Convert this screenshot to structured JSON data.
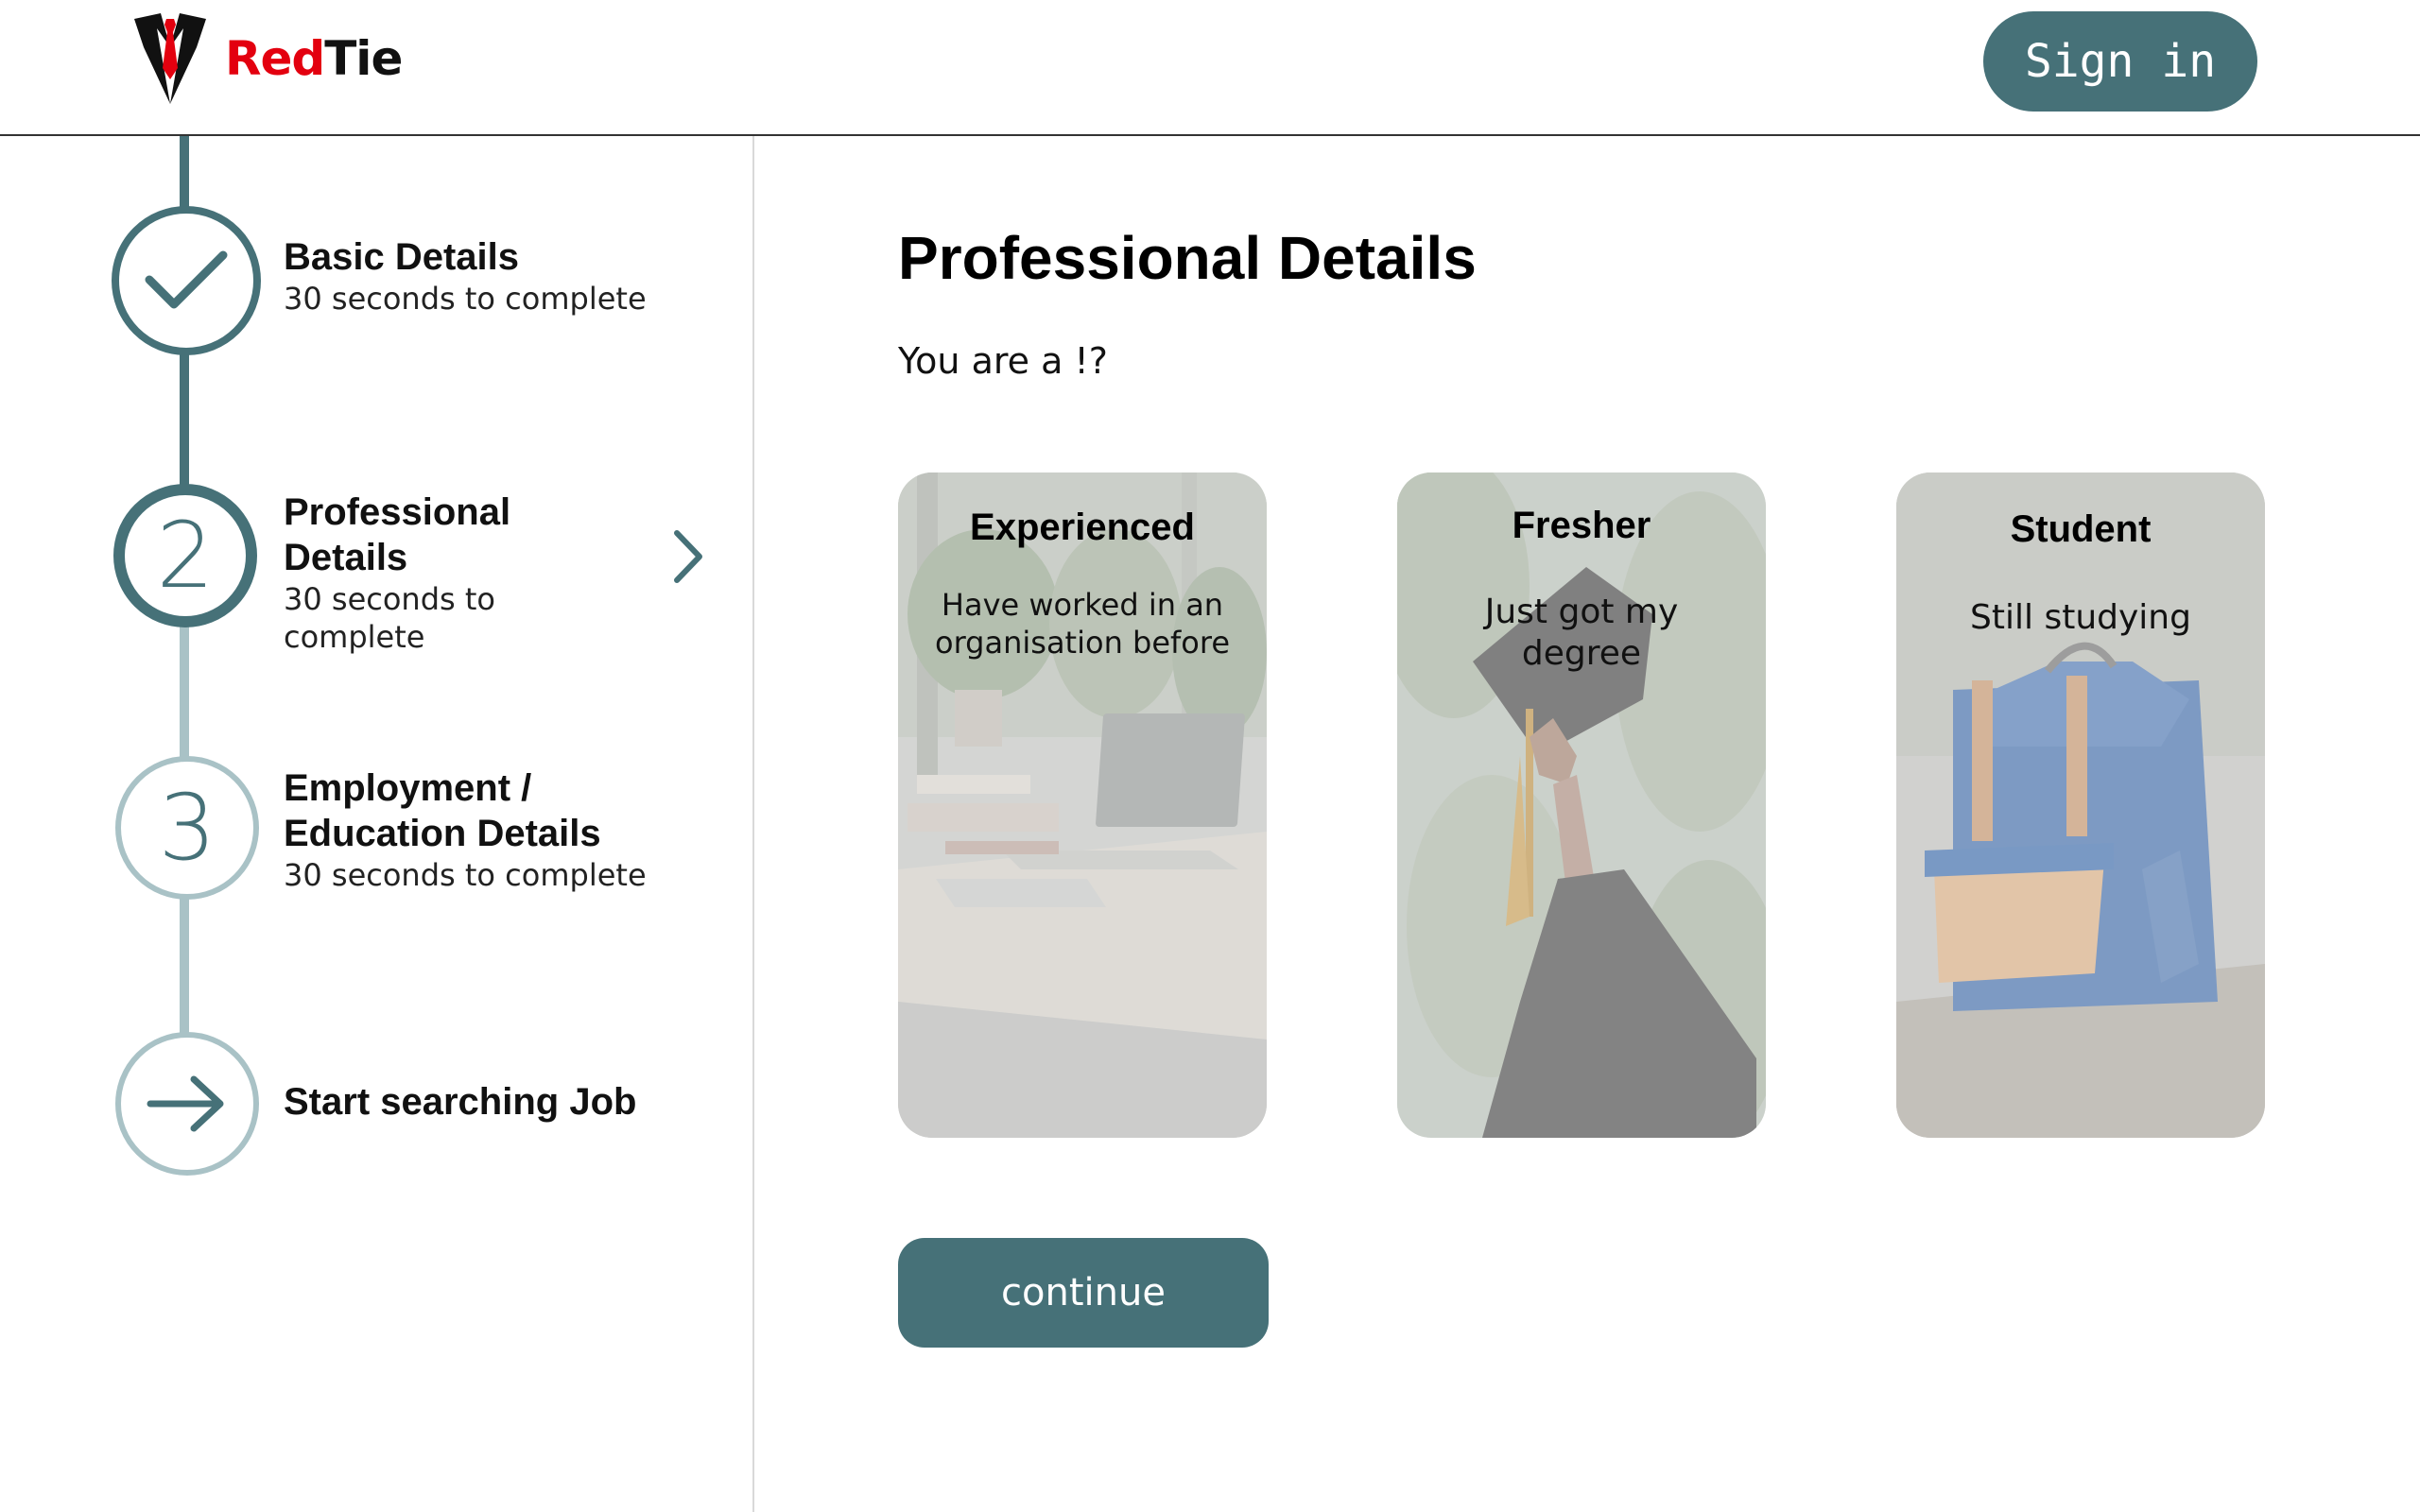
{
  "brand": {
    "name_red": "Red",
    "name_dark": "Tie",
    "accent": "#e3000f"
  },
  "header": {
    "signin_label": "Sign in"
  },
  "colors": {
    "primary": "#467178",
    "inactive": "#a9c2c6"
  },
  "steps": [
    {
      "title": "Basic Details",
      "subtitle": "30 seconds to complete",
      "state": "completed",
      "icon": "check-icon"
    },
    {
      "title": "Professional Details",
      "subtitle": "30 seconds to complete",
      "state": "active",
      "number": "2"
    },
    {
      "title": "Employment / Education Details",
      "subtitle": "30 seconds to complete",
      "state": "pending",
      "number": "3"
    },
    {
      "title": "Start searching Job",
      "state": "pending",
      "icon": "arrow-right-icon"
    }
  ],
  "main": {
    "title": "Professional Details",
    "question": "You are a !?",
    "continue_label": "continue"
  },
  "options": [
    {
      "title": "Experienced",
      "desc_line1": "Have worked in an",
      "desc_line2": "organisation before"
    },
    {
      "title": "Fresher",
      "desc_line1": "Just got my",
      "desc_line2": "degree"
    },
    {
      "title": "Student",
      "desc_line1": "Still studying"
    }
  ]
}
